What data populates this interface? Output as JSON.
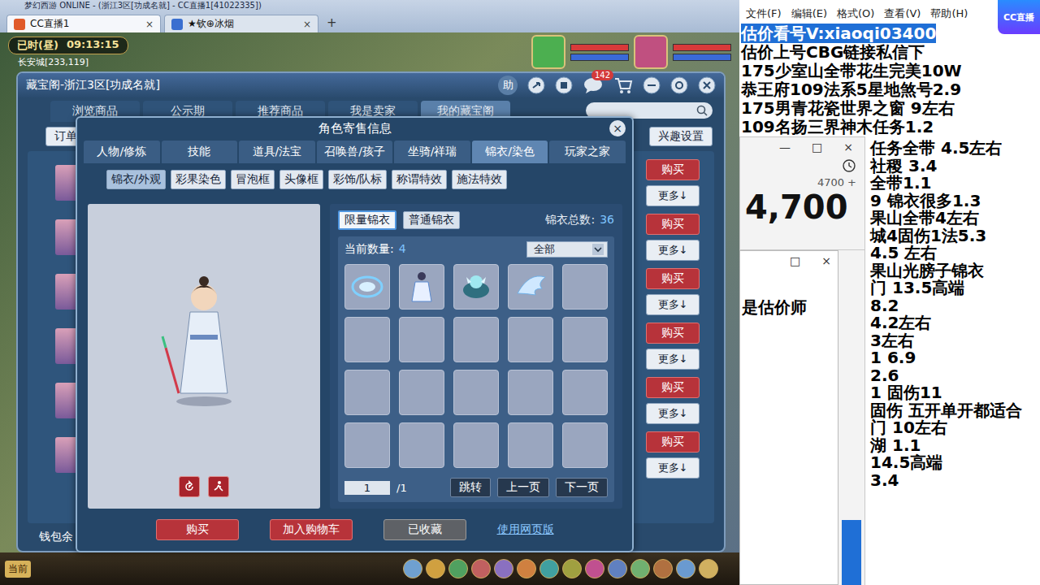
{
  "browser": {
    "title": "梦幻西游 ONLINE - (浙江3区[功成名就] - CC直播1[41022335])",
    "tabs": [
      {
        "label": "CC直播1",
        "selected": true,
        "close": "×"
      },
      {
        "label": "★钦⊕冰烟",
        "selected": false,
        "close": "×"
      }
    ],
    "new_tab": "+"
  },
  "hud": {
    "period": "已时(昼)",
    "clock": "09:13:15",
    "location": "长安城[233,119]"
  },
  "market": {
    "title": "藏宝阁-浙江3区[功成名就]",
    "help": "助",
    "badge": "142",
    "nav": [
      {
        "label": "浏览商品",
        "selected": false
      },
      {
        "label": "公示期",
        "selected": false
      },
      {
        "label": "推荐商品",
        "selected": false
      },
      {
        "label": "我是卖家",
        "selected": false
      },
      {
        "label": "我的藏宝阁",
        "selected": true
      }
    ],
    "order_button": "订单",
    "interest_button": "兴趣设置",
    "rows": [
      {
        "buy": "购买",
        "more": "更多↓"
      },
      {
        "buy": "购买",
        "more": "更多↓"
      },
      {
        "buy": "购买",
        "more": "更多↓"
      },
      {
        "buy": "购买",
        "more": "更多↓"
      },
      {
        "buy": "购买",
        "more": "更多↓"
      },
      {
        "buy": "购买",
        "more": "更多↓"
      }
    ],
    "wallet": "钱包余"
  },
  "dialog": {
    "title": "角色寄售信息",
    "close": "×",
    "tabs": [
      {
        "label": "人物/修炼",
        "selected": false
      },
      {
        "label": "技能",
        "selected": false
      },
      {
        "label": "道具/法宝",
        "selected": false
      },
      {
        "label": "召唤兽/孩子",
        "selected": false
      },
      {
        "label": "坐骑/祥瑞",
        "selected": false
      },
      {
        "label": "锦衣/染色",
        "selected": true
      },
      {
        "label": "玩家之家",
        "selected": false
      }
    ],
    "subtabs": [
      {
        "label": "锦衣/外观",
        "selected": true
      },
      {
        "label": "彩果染色",
        "selected": false
      },
      {
        "label": "冒泡框",
        "selected": false
      },
      {
        "label": "头像框",
        "selected": false
      },
      {
        "label": "彩饰/队标",
        "selected": false
      },
      {
        "label": "称谓特效",
        "selected": false
      },
      {
        "label": "施法特效",
        "selected": false
      }
    ],
    "closet": {
      "toggles": [
        {
          "label": "限量锦衣",
          "selected": true
        },
        {
          "label": "普通锦衣",
          "selected": false
        }
      ],
      "total_label": "锦衣总数:",
      "total": "36",
      "count_label": "当前数量:",
      "count": "4",
      "filter": "全部",
      "slots": [
        {
          "kind": "aura"
        },
        {
          "kind": "outfit"
        },
        {
          "kind": "mount"
        },
        {
          "kind": "wing"
        },
        {
          "kind": "empty"
        },
        {
          "kind": "empty"
        },
        {
          "kind": "empty"
        },
        {
          "kind": "empty"
        },
        {
          "kind": "empty"
        },
        {
          "kind": "empty"
        },
        {
          "kind": "empty"
        },
        {
          "kind": "empty"
        },
        {
          "kind": "empty"
        },
        {
          "kind": "empty"
        },
        {
          "kind": "empty"
        },
        {
          "kind": "empty"
        },
        {
          "kind": "empty"
        },
        {
          "kind": "empty"
        },
        {
          "kind": "empty"
        },
        {
          "kind": "empty"
        }
      ],
      "page": "1",
      "pages": "/1",
      "jump": "跳转",
      "prev": "上一页",
      "next": "下一页"
    },
    "buttons": [
      {
        "label": "购买",
        "kind": "primary"
      },
      {
        "label": "加入购物车",
        "kind": "primary"
      },
      {
        "label": "已收藏",
        "kind": "muted"
      }
    ],
    "web_link": "使用网页版"
  },
  "bottom_bar": {
    "channel": "当前"
  },
  "notepad": {
    "menu": [
      "文件(F)",
      "编辑(E)",
      "格式(O)",
      "查看(V)",
      "帮助(H)"
    ],
    "lines": [
      {
        "text": "估价看号V:xiaoqi03400",
        "selected": true
      },
      {
        "text": "估价上号CBG链接私信下",
        "selected": false
      },
      {
        "text": "175少室山全带花生完美10W",
        "selected": false
      },
      {
        "text": "恭王府109法系5星地煞号2.9",
        "selected": false
      },
      {
        "text": "175男青花瓷世界之窗  9左右",
        "selected": false
      },
      {
        "text": "109名扬三界神木任务1.2",
        "selected": false
      }
    ],
    "partial_lines": [
      "任务全带 4.5左右",
      "社稷  3.4",
      "全带1.1",
      "9  锦衣很多1.3",
      "果山全带4左右",
      "城4固伤1法5.3",
      "4.5 左右",
      "果山光膀子锦衣",
      "门  13.5高端",
      "8.2",
      "4.2左右",
      "3左右",
      "1  6.9",
      "2.6",
      "1 固伤11",
      "固伤 五开单开都适合",
      "门  10左右",
      "湖  1.1",
      "14.5高端",
      "3.4"
    ]
  },
  "calculator": {
    "controls": [
      "—",
      "□",
      "×"
    ],
    "expression": "4700 +",
    "display": "4,700"
  },
  "popup": {
    "controls": [
      "□",
      "×"
    ],
    "text": "是估价师"
  },
  "stream_logo": "CC直播"
}
